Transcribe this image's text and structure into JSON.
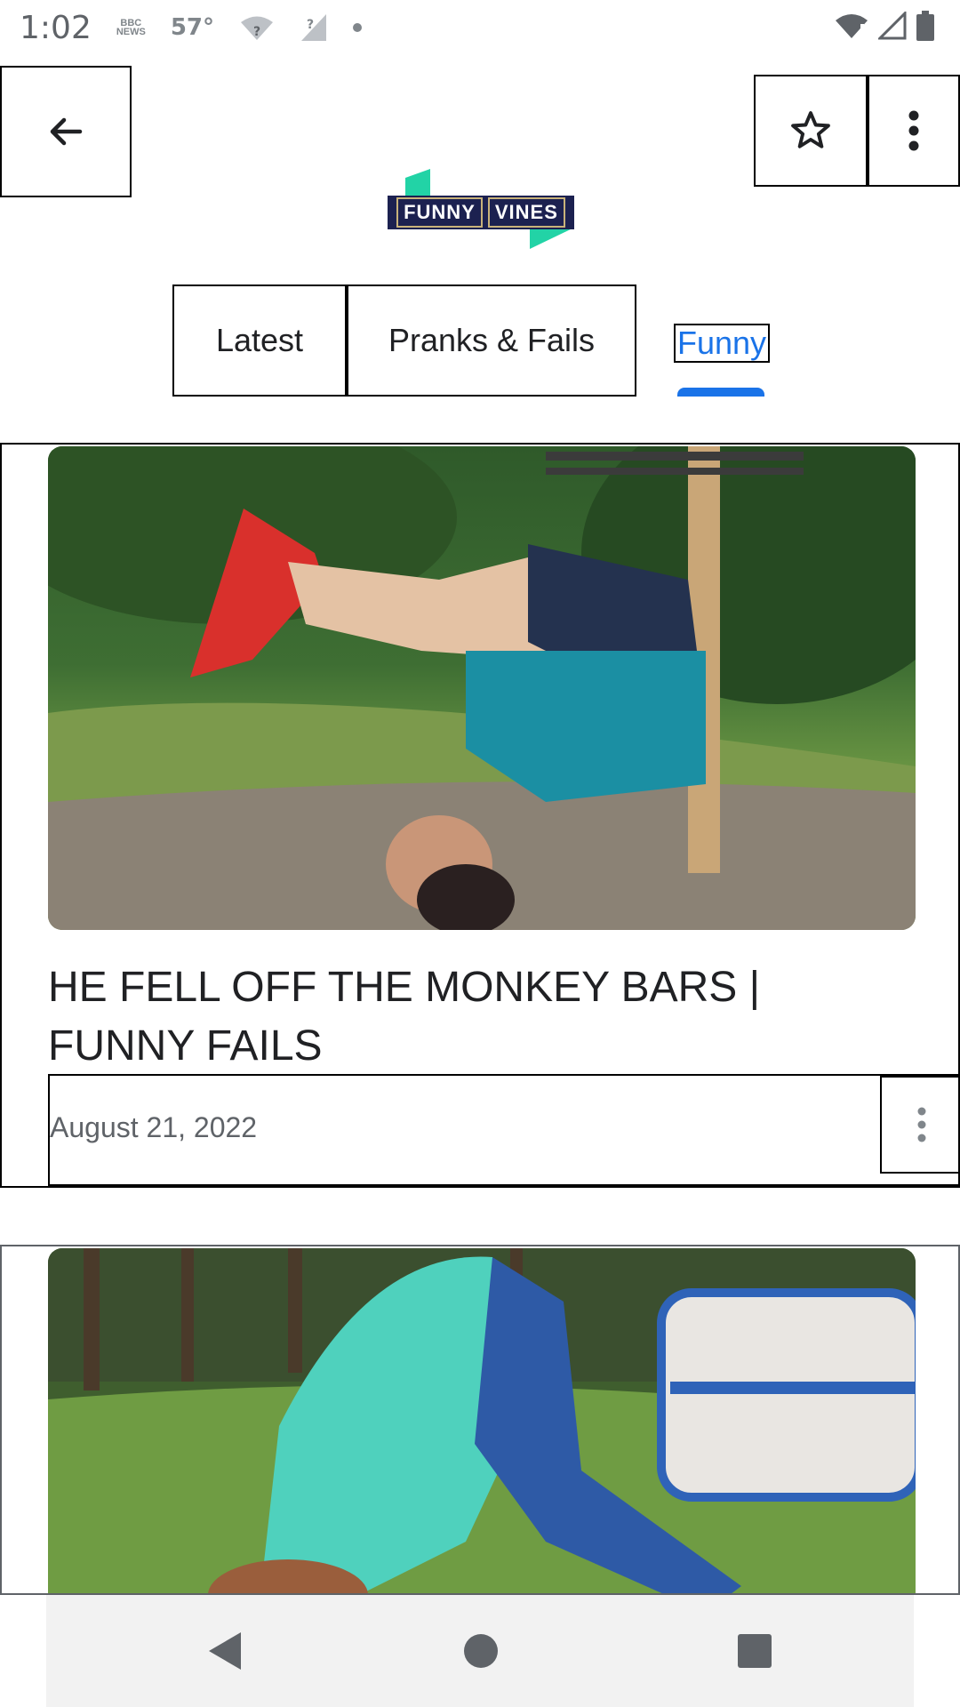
{
  "status_bar": {
    "time": "1:02",
    "news_label": "BBC NEWS",
    "temperature": "57°"
  },
  "top_bar": {
    "back_icon": "arrow-left-icon",
    "star_icon": "star-outline-icon",
    "more_icon": "more-vert-icon"
  },
  "logo": {
    "word_1": "FUNNY",
    "word_2": "VINES",
    "accent_color": "#22d3a6",
    "bg_color": "#1c2150"
  },
  "tabs": [
    {
      "label": "Latest",
      "selected": false
    },
    {
      "label": "Pranks & Fails",
      "selected": false
    },
    {
      "label": "Funny",
      "selected": true
    }
  ],
  "accent_color": "#1a73e8",
  "cards": [
    {
      "title": "HE FELL OFF THE MONKEY BARS | FUNNY FAILS",
      "date": "August 21, 2022",
      "thumbnail": "man-hanging-upside-down-on-monkey-bars-photo"
    },
    {
      "title": "",
      "date": "",
      "thumbnail": "person-falling-on-grass-photo"
    }
  ],
  "nav_bar": {
    "back_icon": "triangle-back-icon",
    "home_icon": "circle-home-icon",
    "recents_icon": "square-recents-icon"
  }
}
